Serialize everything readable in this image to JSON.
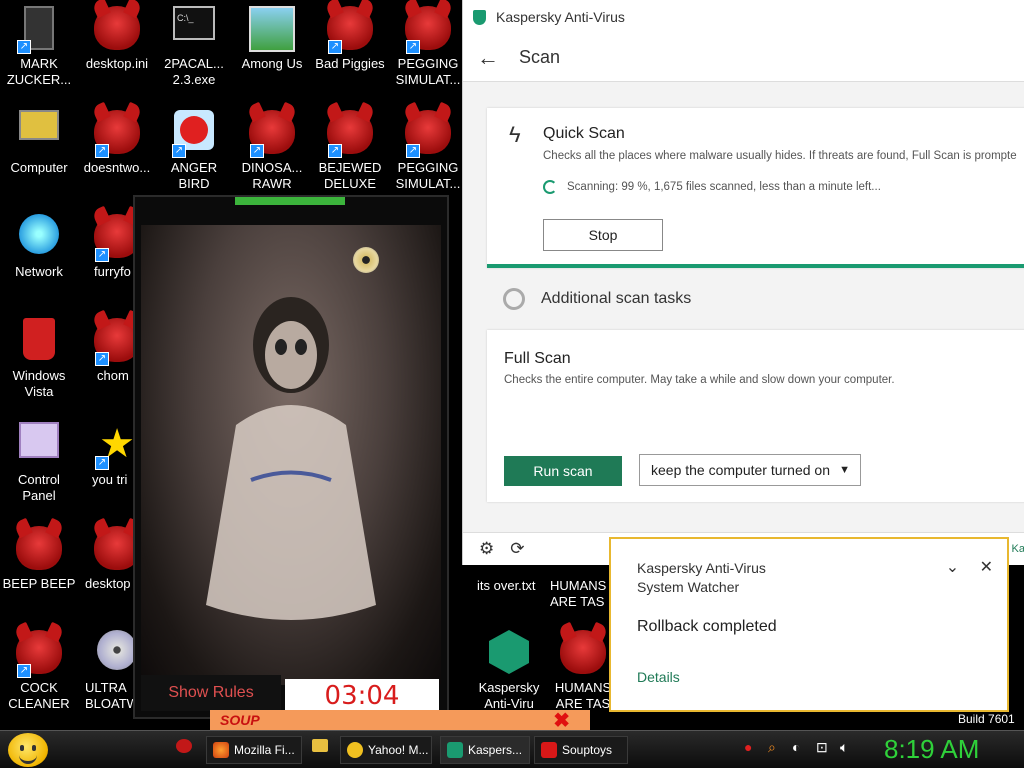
{
  "desktop_icons": [
    {
      "label": "MARK ZUCKER...",
      "icon": "figure-icon"
    },
    {
      "label": "desktop.ini",
      "icon": "devil-icon"
    },
    {
      "label": "2PACAL... 2.3.exe",
      "icon": "console-icon"
    },
    {
      "label": "Among Us",
      "icon": "among-us-icon"
    },
    {
      "label": "Bad Piggies",
      "icon": "devil-icon"
    },
    {
      "label": "PEGGING SIMULAT...",
      "icon": "devil-icon"
    },
    {
      "label": "Computer",
      "icon": "computer-icon"
    },
    {
      "label": "doesntwo...",
      "icon": "devil-icon"
    },
    {
      "label": "ANGER BIRD",
      "icon": "angry-bird-icon"
    },
    {
      "label": "DINOSA... RAWR",
      "icon": "devil-icon"
    },
    {
      "label": "BEJEWED DELUXE",
      "icon": "devil-icon"
    },
    {
      "label": "PEGGING SIMULAT...",
      "icon": "devil-icon"
    },
    {
      "label": "Network",
      "icon": "network-icon"
    },
    {
      "label": "furryfo",
      "icon": "devil-icon"
    },
    {
      "label": "Windows Vista",
      "icon": "recycle-bin-icon"
    },
    {
      "label": "chom",
      "icon": "devil-icon"
    },
    {
      "label": "Control Panel",
      "icon": "control-panel-icon"
    },
    {
      "label": "you tri",
      "icon": "star-icon"
    },
    {
      "label": "BEEP BEEP",
      "icon": "devil-icon"
    },
    {
      "label": "desktop",
      "icon": "devil-icon"
    },
    {
      "label": "COCK CLEANER",
      "icon": "devil-icon"
    },
    {
      "label": "ULTRA BLOATW",
      "icon": "disc-icon"
    }
  ],
  "desktop_bottom_labels": [
    "its over.txt",
    "HUMANS ARE TAS",
    "Kaspersky Anti-Viru",
    "HUMANS ARE TAS"
  ],
  "horror_window": {
    "show_rules": "Show Rules",
    "timer": "03:04"
  },
  "kaspersky": {
    "app_title": "Kaspersky Anti-Virus",
    "page_title": "Scan",
    "quick_scan": {
      "title": "Quick Scan",
      "description": "Checks all the places where malware usually hides. If threats are found, Full Scan is prompte",
      "progress": "Scanning: 99 %, 1,675 files scanned, less than a minute left...",
      "progress_percent": 99,
      "stop_label": "Stop"
    },
    "additional_title": "Additional scan tasks",
    "full_scan": {
      "title": "Full Scan",
      "description": "Checks the entire computer. May take a while and slow down your computer.",
      "run_label": "Run scan",
      "option": "keep the computer turned on"
    },
    "footer_fragment": "Ka"
  },
  "notification": {
    "app": "Kaspersky Anti-Virus",
    "component": "System Watcher",
    "message": "Rollback completed",
    "details": "Details"
  },
  "taskbar": {
    "items": [
      {
        "label": "Mozilla Fi...",
        "icon": "firefox-icon"
      },
      {
        "label": "Yahoo! M...",
        "icon": "yahoo-messenger-icon"
      },
      {
        "label": "Kaspers...",
        "icon": "kaspersky-icon"
      },
      {
        "label": "Souptoys",
        "icon": "souptoys-icon"
      }
    ],
    "clock": "8:19 AM"
  },
  "build": "Build 7601",
  "colors": {
    "kaspersky_green": "#1a9a70",
    "run_button": "#1f7a56",
    "notification_border": "#e8b830",
    "clock": "#2fd13a"
  }
}
